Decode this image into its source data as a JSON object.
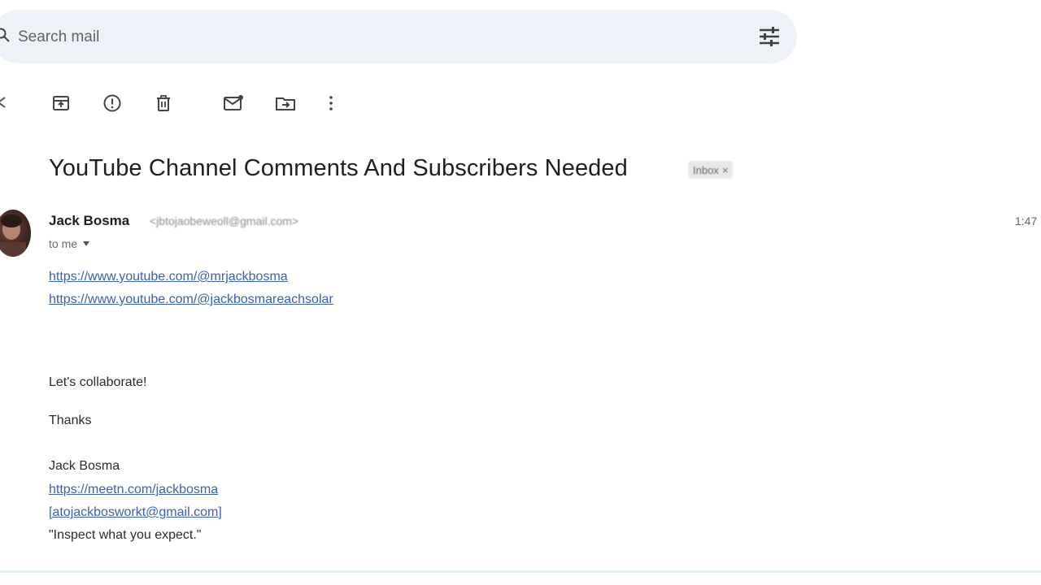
{
  "search": {
    "placeholder": "Search mail"
  },
  "toolbar": {
    "items": [
      {
        "name": "archive",
        "icon": "archive-icon"
      },
      {
        "name": "report-spam",
        "icon": "report-icon"
      },
      {
        "name": "delete",
        "icon": "trash-icon"
      },
      {
        "name": "mark-unread",
        "icon": "mail-icon"
      },
      {
        "name": "move-to",
        "icon": "folder-move-icon"
      },
      {
        "name": "more",
        "icon": "more-vert-icon"
      }
    ]
  },
  "email": {
    "subject": "YouTube Channel Comments And Subscribers Needed",
    "label": "Inbox",
    "label_close": "×",
    "sender_name": "Jack Bosma",
    "sender_email": "<jbtojaobeweoll@gmail.com>",
    "timestamp": "1:47",
    "recipient": "to me",
    "links_top": [
      "https://www.youtube.com/@mrjackbosma",
      "https://www.youtube.com/@jackbosmareachsolar"
    ],
    "line_collab": "Let's collaborate!",
    "line_thanks": "Thanks",
    "signature_name": "Jack Bosma",
    "signature_links": [
      "https://meetn.com/jackbosma",
      "[atojackbosworkt@gmail.com]"
    ],
    "signature_quote": "\"Inspect what you expect.\""
  },
  "colors": {
    "search_bg": "#eef2f8",
    "link": "#3c5fb0",
    "text": "#1f1f1f",
    "bottom_bar": "#dff3e4"
  }
}
